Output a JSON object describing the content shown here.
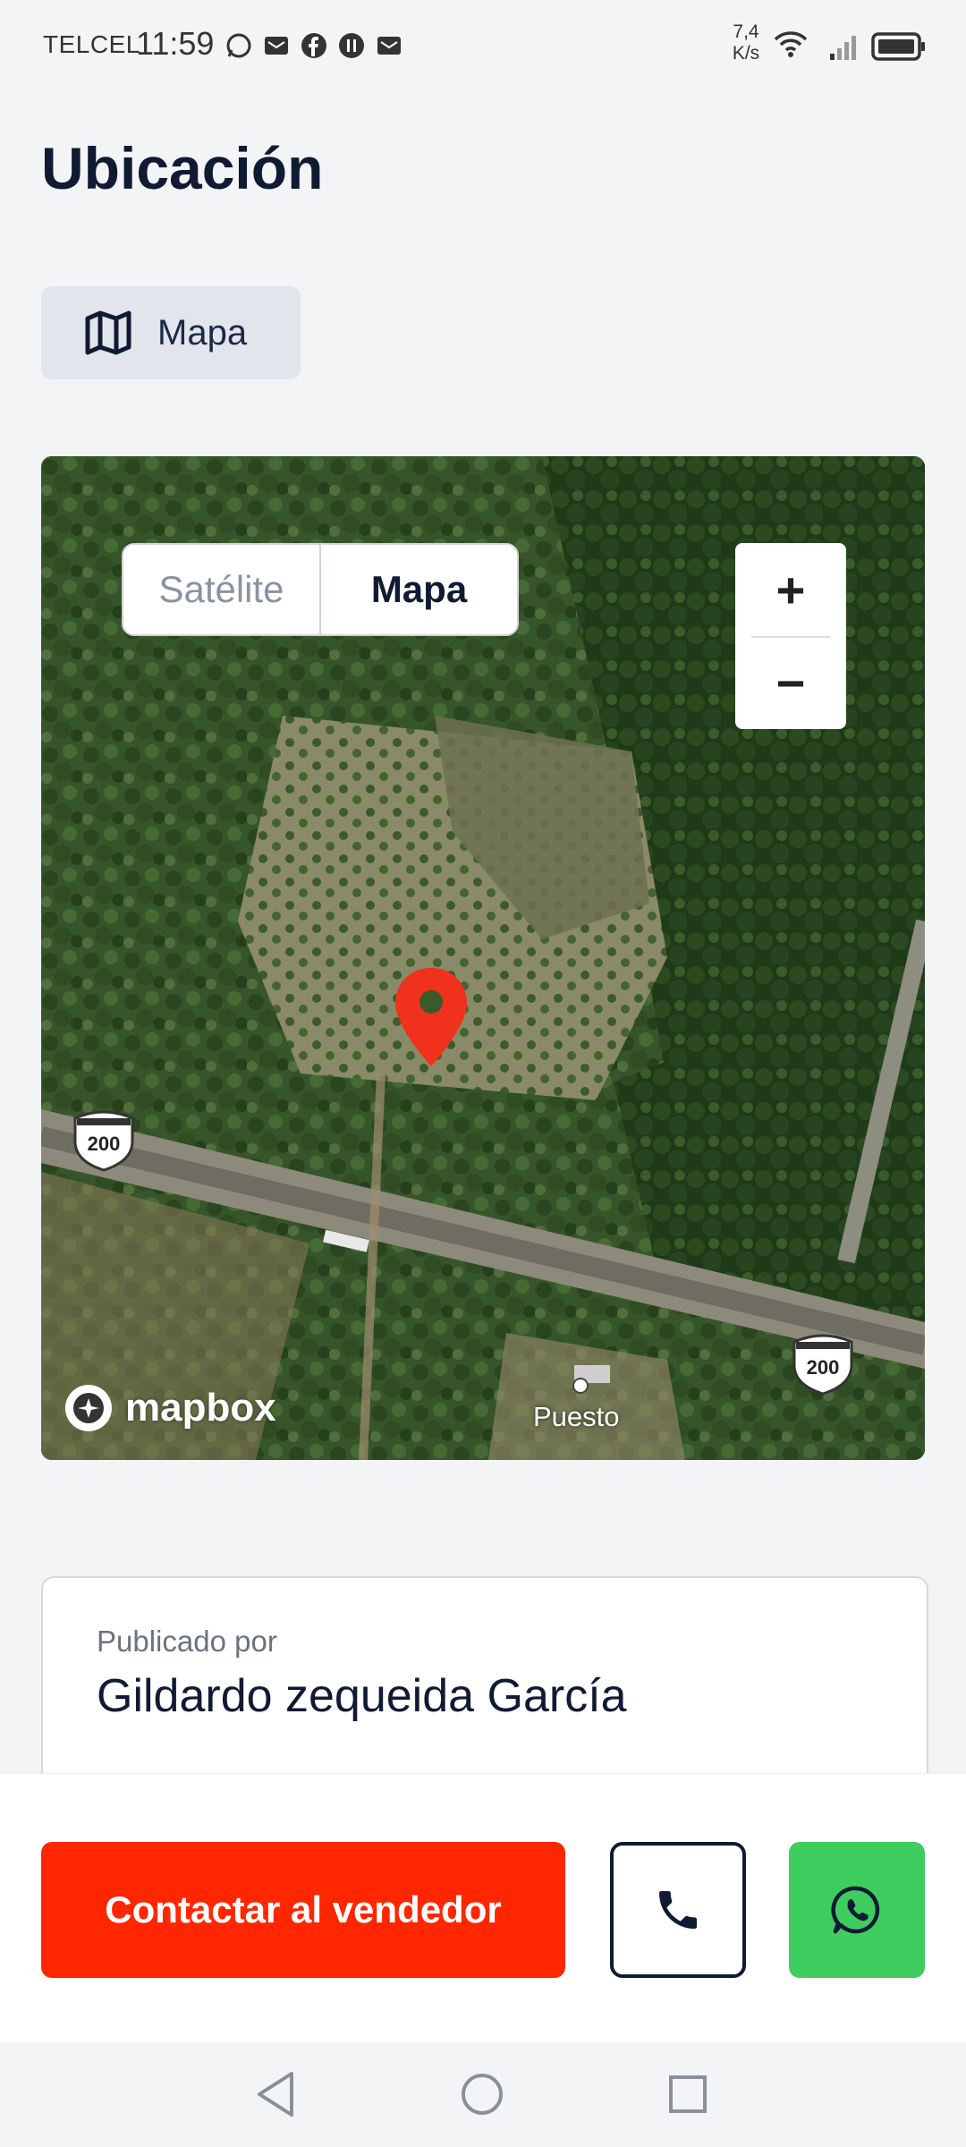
{
  "status_bar": {
    "carrier": "TELCEL",
    "time": "11:59",
    "net_speed_value": "7,4",
    "net_speed_unit": "K/s",
    "notification_icons": [
      "whatsapp-icon",
      "message-icon",
      "facebook-icon",
      "pause-icon",
      "message-icon"
    ],
    "system_icons": [
      "wifi-icon",
      "signal-icon",
      "battery-icon"
    ]
  },
  "page": {
    "title": "Ubicación"
  },
  "view_tabs": {
    "map_label": "Mapa"
  },
  "map": {
    "style_toggle": {
      "satellite_label": "Satélite",
      "map_label": "Mapa",
      "selected": "Mapa"
    },
    "zoom": {
      "in_label": "+",
      "out_label": "−"
    },
    "highway_shield_1": "200",
    "highway_shield_2": "200",
    "poi_label": "Puesto",
    "attribution": "mapbox",
    "marker_color": "#f0311c"
  },
  "seller": {
    "label": "Publicado por",
    "name": "Gildardo zequeida García"
  },
  "actions": {
    "contact_label": "Contactar al vendedor",
    "contact_color": "#ff2600",
    "whatsapp_color": "#3ecd5e"
  },
  "nav_bar": {
    "buttons": [
      "back-icon",
      "home-icon",
      "recents-icon"
    ]
  }
}
